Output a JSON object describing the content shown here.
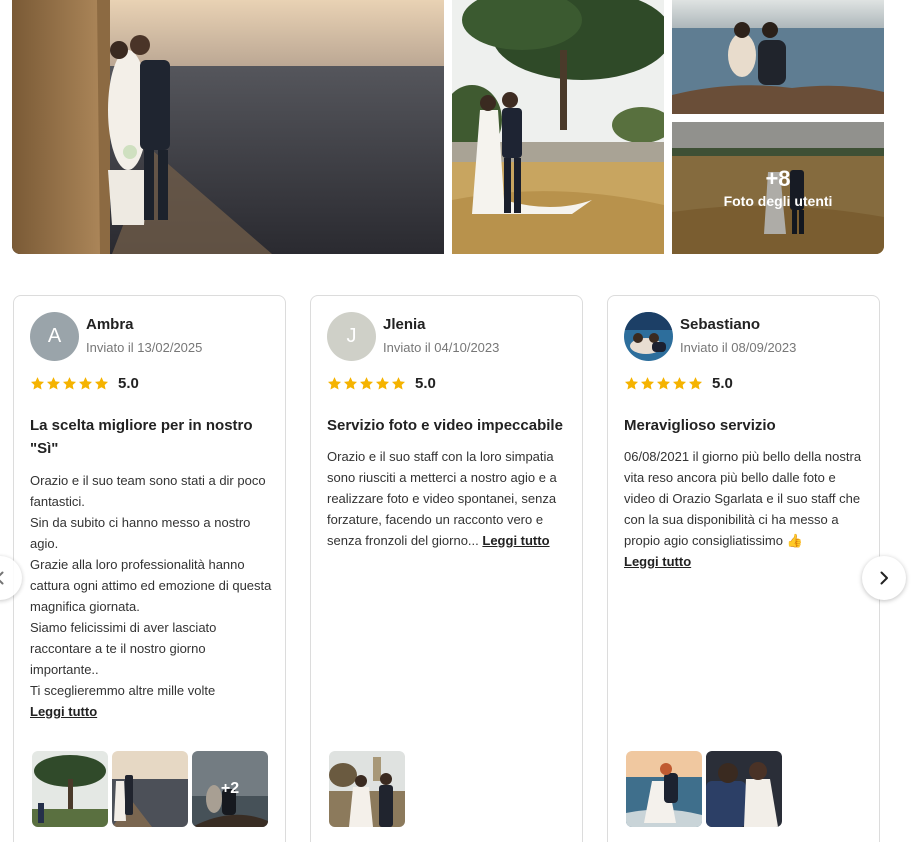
{
  "gallery": {
    "more_count": "+8",
    "more_label": "Foto degli utenti"
  },
  "reviews": [
    {
      "name": "Ambra",
      "avatar_letter": "A",
      "avatar_color": "#9aa4aa",
      "date": "Inviato il 13/02/2025",
      "stars": 5,
      "rating": "5.0",
      "title": "La scelta migliore per in nostro \"Sì\"",
      "body": [
        "Orazio e il suo team sono stati a dir poco fantastici.",
        "Sin da subito ci hanno messo a nostro agio.",
        "Grazie alla loro professionalità hanno cattura ogni attimo ed emozione di questa magnifica giornata.",
        "Siamo felicissimi di aver lasciato raccontare a te il nostro giorno importante..",
        "Ti sceglieremmo altre mille volte"
      ],
      "read_more": "Leggi tutto",
      "thumbs_more": "+2"
    },
    {
      "name": "Jlenia",
      "avatar_letter": "J",
      "avatar_color": "#cfd0c8",
      "date": "Inviato il 04/10/2023",
      "stars": 5,
      "rating": "5.0",
      "title": "Servizio foto e video impeccabile",
      "body": [
        "Orazio e il suo staff con la loro simpatia sono riusciti a metterci a nostro agio e a realizzare foto e video spontanei, senza forzature, facendo un racconto vero e senza fronzoli del giorno..."
      ],
      "read_more": "Leggi tutto"
    },
    {
      "name": "Sebastiano",
      "date": "Inviato il 08/09/2023",
      "stars": 5,
      "rating": "5.0",
      "title": "Meraviglioso servizio",
      "body": [
        "06/08/2021 il giorno più bello della nostra vita reso ancora più bello dalle foto e video di Orazio Sgarlata e il suo staff che con la sua disponibilità ci ha messo a propio agio consigliatissimo 👍"
      ],
      "read_more": "Leggi tutto"
    }
  ],
  "colors": {
    "star": "#f5b300",
    "card_border": "#dcdcdc",
    "muted_text": "#777777"
  },
  "icons": {
    "prev": "chevron-left-icon",
    "next": "chevron-right-icon",
    "star": "star-icon"
  }
}
